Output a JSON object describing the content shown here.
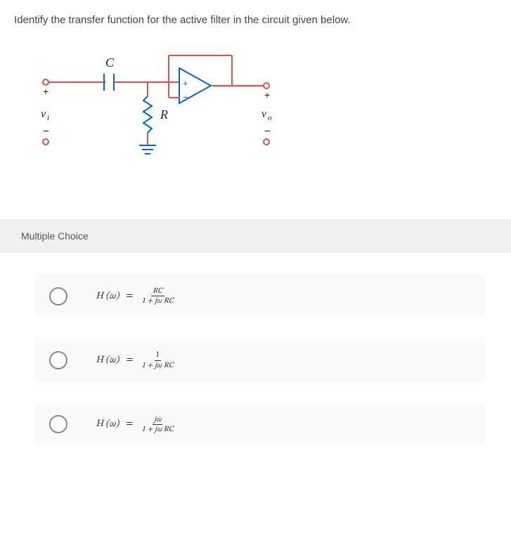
{
  "question": "Identify the transfer function for the active filter in the circuit given below.",
  "circuit": {
    "input_label": "v_i",
    "output_label": "v_o",
    "capacitor": "C",
    "resistor": "R"
  },
  "mc_header": "Multiple Choice",
  "options": [
    {
      "lhs": "H (ω)",
      "eq": "=",
      "num": "RC",
      "den": "1 + jω RC"
    },
    {
      "lhs": "H (ω)",
      "eq": "=",
      "num": "1",
      "den": "1 + jω RC"
    },
    {
      "lhs": "H (ω)",
      "eq": "=",
      "num": "jω",
      "den": "1 + jω RC"
    }
  ]
}
